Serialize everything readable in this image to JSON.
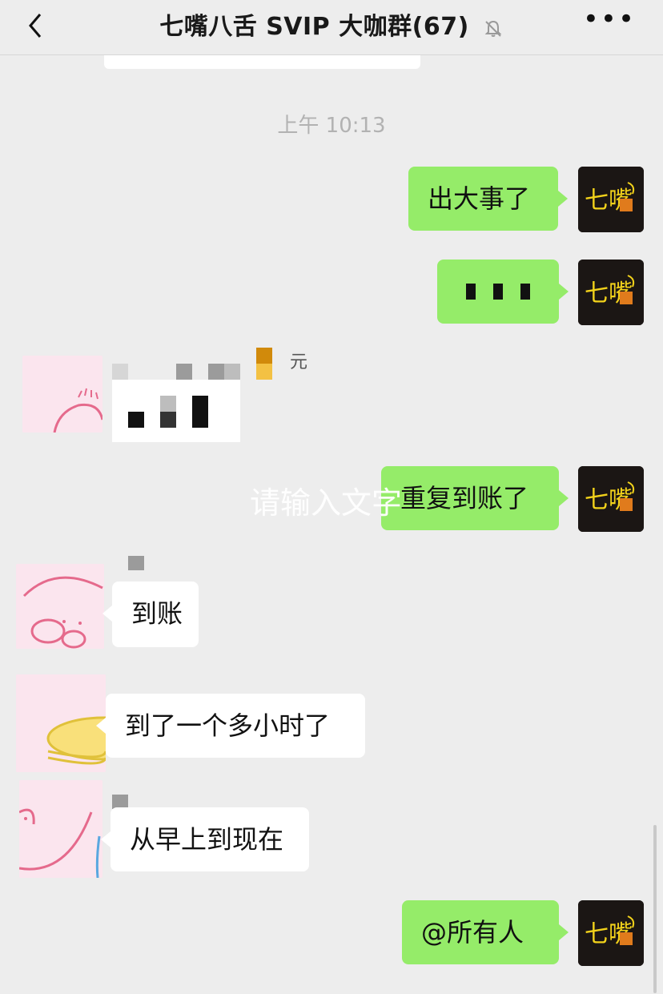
{
  "header": {
    "back_icon": "chevron-left-icon",
    "title": "七嘴八舌 SVIP 大咖群(67)",
    "mute_icon": "bell-muted-icon",
    "more_icon": "more-icon",
    "more_glyph": "•••"
  },
  "timestamp": "上午 10:13",
  "messages": [
    {
      "side": "self",
      "text": "出大事了"
    },
    {
      "side": "self",
      "text": "",
      "content": "three-black-squares"
    },
    {
      "side": "other",
      "text": "",
      "content": "pixelated-mosaic",
      "unit": "元"
    },
    {
      "side": "self",
      "text": "重复到账了"
    },
    {
      "side": "other",
      "text": "到账"
    },
    {
      "side": "other",
      "text": "到了一个多小时了"
    },
    {
      "side": "other",
      "text": "从早上到现在"
    },
    {
      "side": "self",
      "text": "@所有人"
    }
  ],
  "watermark": "请输入文字",
  "colors": {
    "self_bubble": "#95ec69",
    "other_bubble": "#ffffff",
    "background": "#ededed",
    "timestamp": "#b2b2b2"
  }
}
